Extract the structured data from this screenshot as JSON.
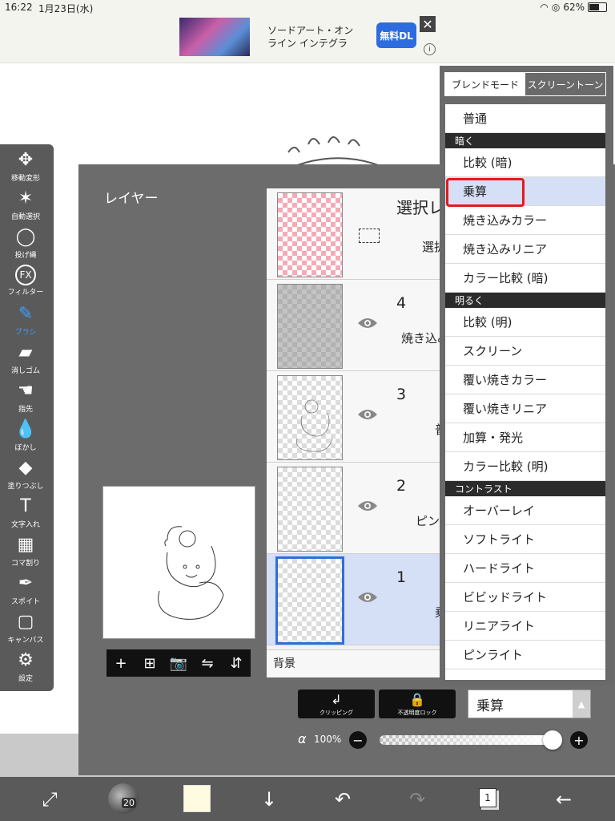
{
  "status_bar": {
    "time": "16:22",
    "date": "1月23日(水)",
    "battery": "62%",
    "battery_level": 0.62
  },
  "ad": {
    "title": "ソードアート・オンライン インテグラ",
    "button": "無料DL",
    "close": "✕",
    "info": "i"
  },
  "toolbar": {
    "tools": [
      {
        "label": "移動変形",
        "icon": "move-icon",
        "glyph": "✥"
      },
      {
        "label": "自動選択",
        "icon": "magic-wand-icon",
        "glyph": "✶"
      },
      {
        "label": "投げ縄",
        "icon": "lasso-icon",
        "glyph": "◯"
      },
      {
        "label": "フィルター",
        "icon": "fx-icon",
        "glyph": "FX"
      },
      {
        "label": "ブラシ",
        "icon": "brush-icon",
        "glyph": "✎"
      },
      {
        "label": "消しゴム",
        "icon": "eraser-icon",
        "glyph": "▰"
      },
      {
        "label": "指先",
        "icon": "finger-icon",
        "glyph": "☚"
      },
      {
        "label": "ぼかし",
        "icon": "blur-icon",
        "glyph": "💧"
      },
      {
        "label": "塗りつぶし",
        "icon": "fill-icon",
        "glyph": "◆"
      },
      {
        "label": "文字入れ",
        "icon": "text-icon",
        "glyph": "T"
      },
      {
        "label": "コマ割り",
        "icon": "frame-icon",
        "glyph": "▦"
      },
      {
        "label": "スポイト",
        "icon": "eyedropper-icon",
        "glyph": "✒"
      },
      {
        "label": "キャンバス",
        "icon": "canvas-icon",
        "glyph": "▢"
      },
      {
        "label": "設定",
        "icon": "settings-icon",
        "glyph": "⚙"
      }
    ],
    "active_tool": "ブラシ"
  },
  "layer_panel": {
    "title": "レイヤー",
    "rows": [
      {
        "number": "",
        "name": "選択レ",
        "mode": "選択",
        "thumb": "pink",
        "icon": "selection-icon"
      },
      {
        "number": "4",
        "name": "",
        "mode": "焼き込み",
        "thumb": "grayfill",
        "icon": "eye-icon"
      },
      {
        "number": "3",
        "name": "",
        "mode": "普",
        "thumb": "sketch",
        "icon": "eye-icon"
      },
      {
        "number": "2",
        "name": "",
        "mode": "ピン",
        "thumb": "plain",
        "icon": "eye-icon"
      },
      {
        "number": "1",
        "name": "",
        "mode": "乗",
        "thumb": "plain",
        "icon": "eye-icon",
        "selected": true
      }
    ],
    "background_label": "背景",
    "preview_actions": [
      {
        "icon": "add-layer-icon",
        "glyph": "+"
      },
      {
        "icon": "add-folder-icon",
        "glyph": "⊞"
      },
      {
        "icon": "camera-icon",
        "glyph": "📷"
      },
      {
        "icon": "flip-horizontal-icon",
        "glyph": "⇋"
      },
      {
        "icon": "flip-vertical-icon",
        "glyph": "⇵"
      }
    ],
    "clipping_label": "クリッピング",
    "alpha_lock_label": "不透明度ロック",
    "blend_mode_value": "乗算",
    "alpha_symbol": "α",
    "opacity": "100%",
    "opacity_level": 1.0
  },
  "blend_menu": {
    "tabs": [
      "ブレンドモード",
      "スクリーントーン"
    ],
    "active_tab": 0,
    "entries": [
      {
        "type": "item",
        "label": "普通"
      },
      {
        "type": "section",
        "label": "暗く"
      },
      {
        "type": "item",
        "label": "比較 (暗)"
      },
      {
        "type": "item",
        "label": "乗算",
        "selected": true
      },
      {
        "type": "item",
        "label": "焼き込みカラー"
      },
      {
        "type": "item",
        "label": "焼き込みリニア"
      },
      {
        "type": "item",
        "label": "カラー比較 (暗)"
      },
      {
        "type": "section",
        "label": "明るく"
      },
      {
        "type": "item",
        "label": "比較 (明)"
      },
      {
        "type": "item",
        "label": "スクリーン"
      },
      {
        "type": "item",
        "label": "覆い焼きカラー"
      },
      {
        "type": "item",
        "label": "覆い焼きリニア"
      },
      {
        "type": "item",
        "label": "加算・発光"
      },
      {
        "type": "item",
        "label": "カラー比較 (明)"
      },
      {
        "type": "section",
        "label": "コントラスト"
      },
      {
        "type": "item",
        "label": "オーバーレイ"
      },
      {
        "type": "item",
        "label": "ソフトライト"
      },
      {
        "type": "item",
        "label": "ハードライト"
      },
      {
        "type": "item",
        "label": "ビビッドライト"
      },
      {
        "type": "item",
        "label": "リニアライト"
      },
      {
        "type": "item",
        "label": "ピンライト"
      }
    ]
  },
  "bottom_toolbar": {
    "brush_size": "20",
    "layer_count": "1",
    "color": "#fffbe0",
    "buttons": [
      {
        "icon": "transform-icon",
        "glyph": "⤢"
      },
      {
        "icon": "down-arrow-icon",
        "glyph": "↓"
      },
      {
        "icon": "undo-icon",
        "glyph": "↶"
      },
      {
        "icon": "redo-icon",
        "glyph": "↷"
      },
      {
        "icon": "back-arrow-icon",
        "glyph": "←"
      }
    ]
  }
}
